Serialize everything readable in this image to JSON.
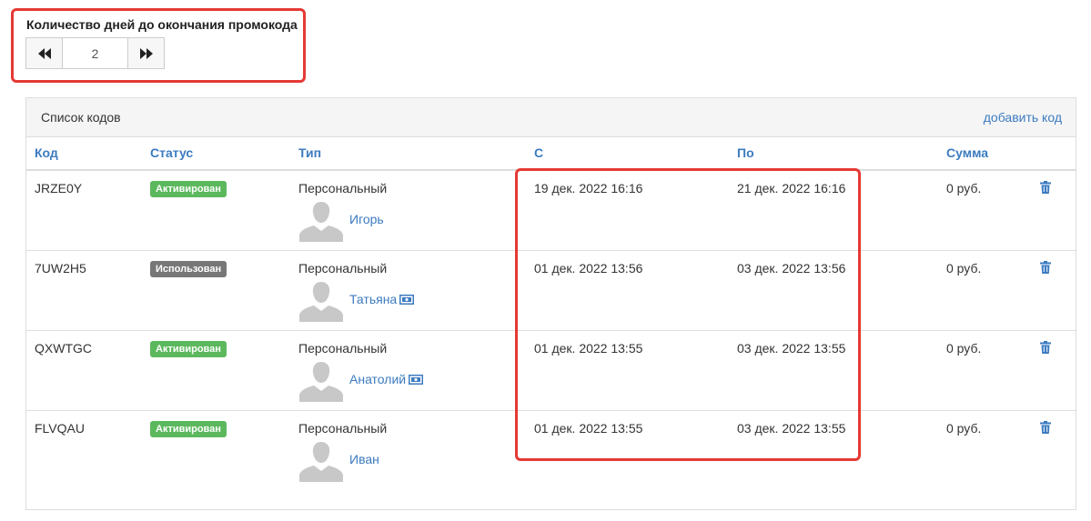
{
  "promo_days": {
    "label": "Количество дней до окончания промокода",
    "value": "2",
    "decrement_icon": "double-chevron-left-icon",
    "increment_icon": "double-chevron-right-icon"
  },
  "panel": {
    "title": "Список кодов",
    "add_link": "добавить код"
  },
  "table": {
    "headers": {
      "code": "Код",
      "status": "Статус",
      "type": "Тип",
      "from": "С",
      "to": "По",
      "sum": "Сумма"
    },
    "rows": [
      {
        "code": "JRZE0Y",
        "status": "Активирован",
        "status_kind": "active",
        "type": "Персональный",
        "user": "Игорь",
        "money_icon": false,
        "from": "19 дек. 2022 16:16",
        "to": "21 дек. 2022 16:16",
        "sum": "0 руб."
      },
      {
        "code": "7UW2H5",
        "status": "Использован",
        "status_kind": "used",
        "type": "Персональный",
        "user": "Татьяна",
        "money_icon": true,
        "from": "01 дек. 2022 13:56",
        "to": "03 дек. 2022 13:56",
        "sum": "0 руб."
      },
      {
        "code": "QXWTGC",
        "status": "Активирован",
        "status_kind": "active",
        "type": "Персональный",
        "user": "Анатолий",
        "money_icon": true,
        "from": "01 дек. 2022 13:55",
        "to": "03 дек. 2022 13:55",
        "sum": "0 руб."
      },
      {
        "code": "FLVQAU",
        "status": "Активирован",
        "status_kind": "active",
        "type": "Персональный",
        "user": "Иван",
        "money_icon": false,
        "from": "01 дек. 2022 13:55",
        "to": "03 дек. 2022 13:55",
        "sum": "0 руб."
      }
    ]
  },
  "colors": {
    "highlight": "#e53935",
    "link": "#3c7bc0",
    "badge_active": "#5cb85c",
    "badge_used": "#777777"
  }
}
